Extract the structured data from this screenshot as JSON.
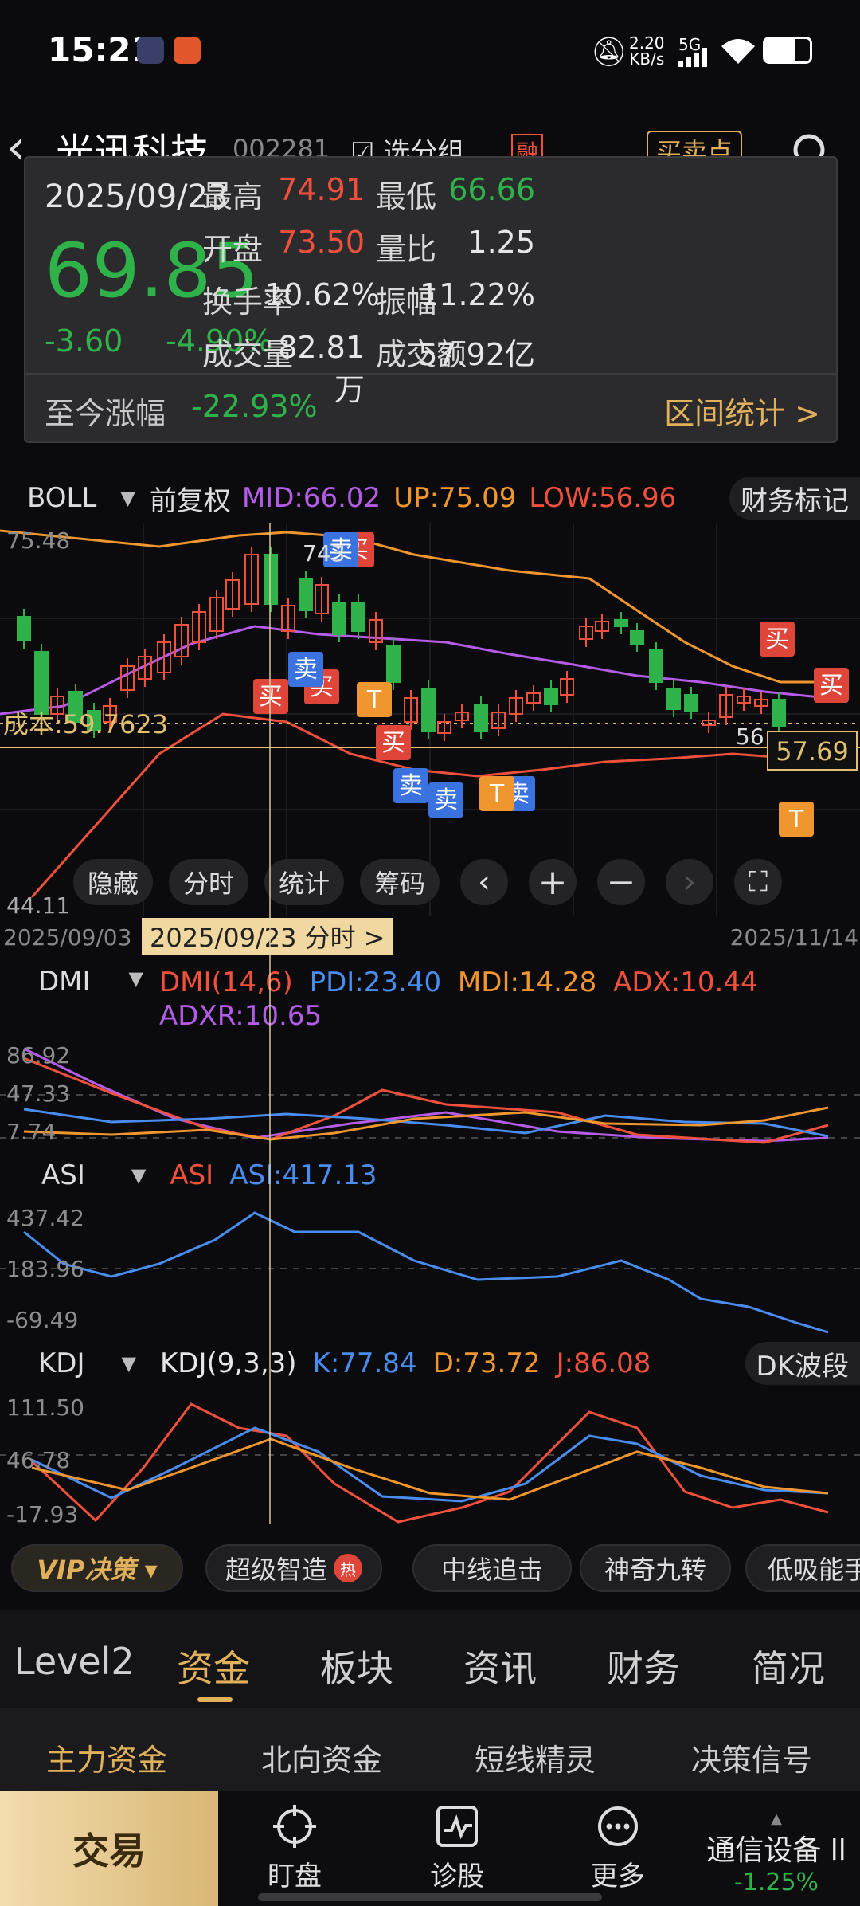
{
  "status_bar": {
    "time": "15:21",
    "net_speed": "2.20",
    "net_unit": "KB/s",
    "network": "5G"
  },
  "header": {
    "back": "‹",
    "stock_name": "光迅科技",
    "stock_code": "002281",
    "group_label": "选分组",
    "margin_tag": "融",
    "bs_label": "买卖点"
  },
  "popup": {
    "date": "2025/09/23",
    "price": "69.85",
    "change": "-3.60",
    "change_pct": "-4.90%",
    "rows": [
      {
        "k1": "最高",
        "v1": "74.91",
        "c1": "red",
        "k2": "最低",
        "v2": "66.66",
        "c2": "green"
      },
      {
        "k1": "开盘",
        "v1": "73.50",
        "c1": "red",
        "k2": "量比",
        "v2": "1.25",
        "c2": "white"
      },
      {
        "k1": "换手率",
        "v1": "10.62%",
        "c1": "white",
        "k2": "振幅",
        "v2": "11.22%",
        "c2": "white"
      },
      {
        "k1": "成交量",
        "v1": "82.81万",
        "c1": "white",
        "k2": "成交额",
        "v2": "57.92亿",
        "c2": "white"
      }
    ],
    "since_label": "至今涨幅",
    "since_value": "-22.93%",
    "range_stats": "区间统计 >"
  },
  "boll": {
    "name": "BOLL",
    "adjust": "前复权",
    "mid": "MID:66.02",
    "up": "UP:75.09",
    "low": "LOW:56.96",
    "fin_mark": "财务标记",
    "y_top": "75.48",
    "y_bottom": "44.11",
    "cost_label": "成本:59.7623",
    "last_price": "57.69",
    "peak_label": "743",
    "low_label": "56"
  },
  "toolbar": {
    "hide": "隐藏",
    "intraday": "分时",
    "stats": "统计",
    "chips": "筹码"
  },
  "date_axis": {
    "start": "2025/09/03",
    "selected": "2025/09/23 分时 >",
    "end": "2025/11/14"
  },
  "dmi": {
    "name": "DMI",
    "params": "DMI(14,6)",
    "pdi": "PDI:23.40",
    "mdi": "MDI:14.28",
    "adx": "ADX:10.44",
    "adxr": "ADXR:10.65",
    "y1": "86.92",
    "y2": "47.33",
    "y3": "7.74"
  },
  "asi": {
    "name": "ASI",
    "label": "ASI",
    "value": "ASI:417.13",
    "y1": "437.42",
    "y2": "183.96",
    "y3": "-69.49"
  },
  "kdj": {
    "name": "KDJ",
    "params": "KDJ(9,3,3)",
    "k": "K:77.84",
    "d": "D:73.72",
    "j": "J:86.08",
    "dk": "DK波段",
    "y1": "111.50",
    "y2": "46.78",
    "y3": "-17.93"
  },
  "strategy": {
    "vip": "VIP决策 ▾",
    "items": [
      "超级智造",
      "中线追击",
      "神奇九转",
      "低吸能手"
    ],
    "hot": "热"
  },
  "tabs": [
    "Level2",
    "资金",
    "板块",
    "资讯",
    "财务",
    "简况"
  ],
  "subtabs": [
    "主力资金",
    "北向资金",
    "短线精灵",
    "决策信号"
  ],
  "bottom_nav": {
    "trade": "交易",
    "watch": "盯盘",
    "diagnose": "诊股",
    "more": "更多",
    "sector": "通信设备 ll",
    "sector_change": "-1.25%"
  },
  "signal_labels": {
    "buy": "买",
    "sell": "卖",
    "t": "T"
  },
  "colors": {
    "up": "#f0503c",
    "down": "#2fb24a",
    "mid": "#b45ce8",
    "upper": "#f0962e",
    "lower": "#f0503c",
    "accent": "#e0b05a"
  }
}
